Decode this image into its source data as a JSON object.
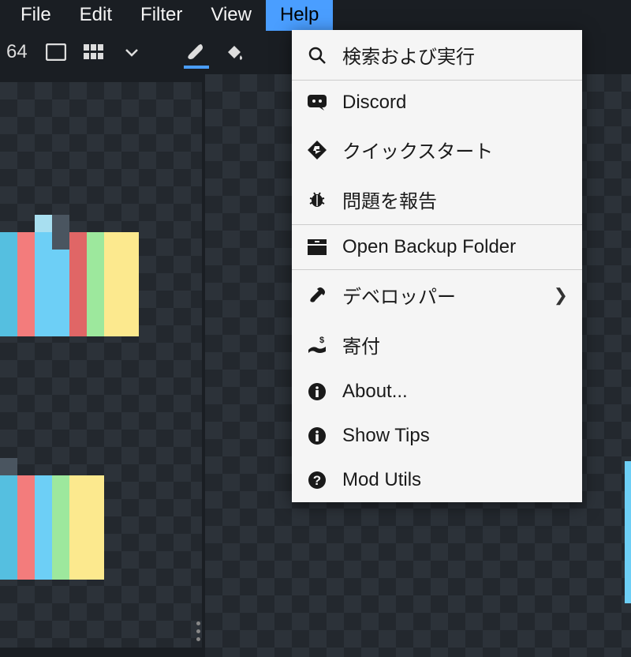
{
  "menubar": {
    "items": [
      {
        "label": "File"
      },
      {
        "label": "Edit"
      },
      {
        "label": "Filter"
      },
      {
        "label": "View"
      },
      {
        "label": "Help",
        "active": true
      }
    ]
  },
  "toolbar": {
    "zoom_value": "64"
  },
  "help_menu": {
    "items": [
      {
        "icon": "search-icon",
        "label": "検索および実行"
      },
      {
        "icon": "discord-icon",
        "label": "Discord"
      },
      {
        "icon": "quickstart-icon",
        "label": "クイックスタート"
      },
      {
        "icon": "bug-icon",
        "label": "問題を報告"
      },
      {
        "icon": "folder-icon",
        "label": "Open Backup Folder",
        "sep": true
      },
      {
        "icon": "wrench-icon",
        "label": "デベロッパー",
        "submenu": true,
        "sep": true
      },
      {
        "icon": "donate-icon",
        "label": "寄付"
      },
      {
        "icon": "info-icon",
        "label": "About..."
      },
      {
        "icon": "info-icon",
        "label": "Show Tips"
      },
      {
        "icon": "question-icon",
        "label": "Mod Utils"
      }
    ]
  }
}
